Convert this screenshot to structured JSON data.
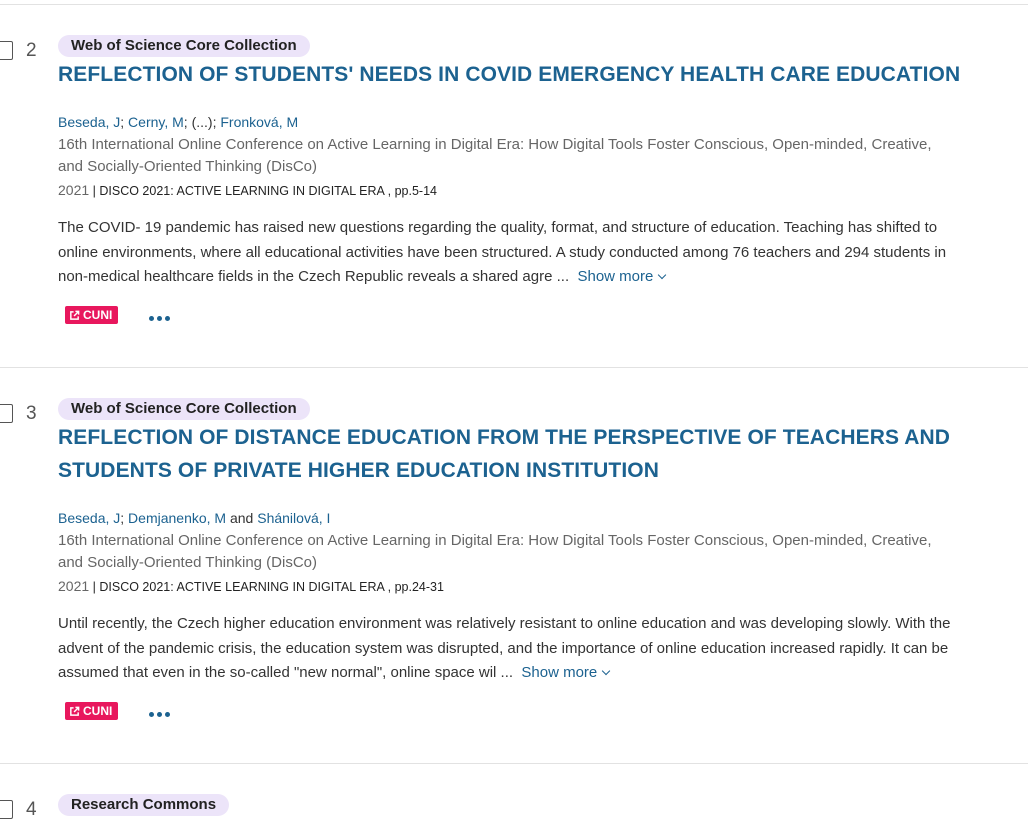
{
  "records": [
    {
      "number": "2",
      "source_badge": "Web of Science Core Collection",
      "title": "REFLECTION OF STUDENTS' NEEDS IN COVID EMERGENCY HEALTH CARE EDUCATION",
      "authors": [
        "Beseda, J",
        "Cerny, M",
        "Fronková, M"
      ],
      "author_sep": ";",
      "author_ellipsis": "(...)",
      "conference": "16th International Online Conference on Active Learning in Digital Era: How Digital Tools Foster Conscious, Open-minded, Creative, and Socially-Oriented Thinking (DisCo)",
      "year": "2021",
      "pub_sep": "|",
      "source_pages": "DISCO 2021: ACTIVE LEARNING IN DIGITAL ERA , pp.5-14",
      "abstract": "The COVID- 19 pandemic has raised new questions regarding the quality, format, and structure of education. Teaching has shifted to online environments, where all educational activities have been structured. A study conducted among 76 teachers and 294 students in non-medical healthcare fields in the Czech Republic reveals a shared agre ...",
      "show_more": "Show more",
      "link_button": "CUNI"
    },
    {
      "number": "3",
      "source_badge": "Web of Science Core Collection",
      "title": "REFLECTION OF DISTANCE EDUCATION FROM THE PERSPECTIVE OF TEACHERS AND STUDENTS OF PRIVATE HIGHER EDUCATION INSTITUTION",
      "authors": [
        "Beseda, J",
        "Demjanenko, M",
        "Shánilová, I"
      ],
      "author_sep": ";",
      "author_and": "and",
      "conference": "16th International Online Conference on Active Learning in Digital Era: How Digital Tools Foster Conscious, Open-minded, Creative, and Socially-Oriented Thinking (DisCo)",
      "year": "2021",
      "pub_sep": "|",
      "source_pages": "DISCO 2021: ACTIVE LEARNING IN DIGITAL ERA , pp.24-31",
      "abstract": "Until recently, the Czech higher education environment was relatively resistant to online education and was developing slowly. With the advent of the pandemic crisis, the education system was disrupted, and the importance of online education increased rapidly. It can be assumed that even in the so-called \"new normal\", online space wil ...",
      "show_more": "Show more",
      "link_button": "CUNI"
    },
    {
      "number": "4",
      "source_badge": "Research Commons"
    }
  ],
  "colors": {
    "link": "#1c6290",
    "badge_bg": "#ece4f9",
    "cuni_bg": "#e8175d",
    "divider": "#e2e2e2"
  }
}
